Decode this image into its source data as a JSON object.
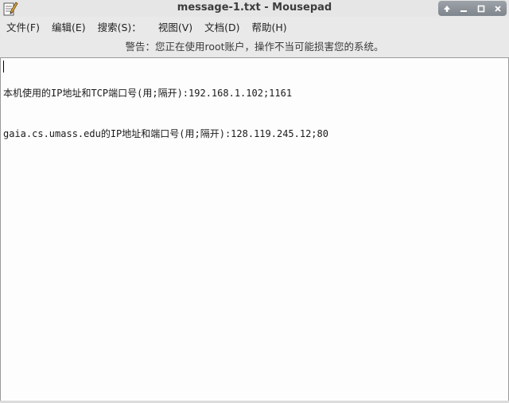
{
  "window": {
    "title": "message-1.txt - Mousepad"
  },
  "icons": {
    "app": "text-editor-notepad-icon",
    "controls": [
      "up-arrow-icon",
      "minimize-icon",
      "maximize-icon",
      "close-icon"
    ]
  },
  "menu": {
    "items": [
      {
        "label": "文件(F)"
      },
      {
        "label": "编辑(E)"
      },
      {
        "label": "搜索(S)："
      },
      {
        "label": "视图(V)"
      },
      {
        "label": "文档(D)"
      },
      {
        "label": "帮助(H)"
      }
    ]
  },
  "warning": {
    "text": "警告：您正在使用root账户，操作不当可能损害您的系统。"
  },
  "document": {
    "lines": [
      "本机使用的IP地址和TCP端口号(用;隔开):192.168.1.102;1161",
      "gaia.cs.umass.edu的IP地址和端口号(用;隔开):128.119.245.12;80"
    ]
  }
}
